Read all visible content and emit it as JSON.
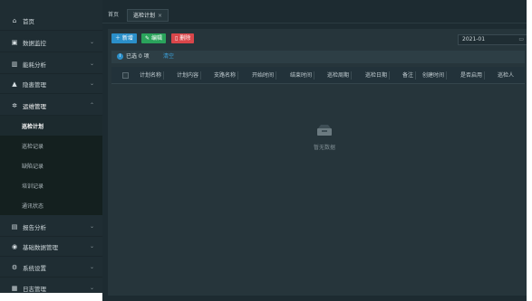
{
  "sidebar": {
    "items": [
      {
        "label": "首页",
        "icon": "home-icon",
        "has_chevron": false
      },
      {
        "label": "数据监控",
        "icon": "monitor-icon",
        "has_chevron": true
      },
      {
        "label": "能耗分析",
        "icon": "bar-chart-icon",
        "has_chevron": true
      },
      {
        "label": "隐患管理",
        "icon": "warning-icon",
        "has_chevron": true
      },
      {
        "label": "运维管理",
        "icon": "gear-icon",
        "has_chevron": true,
        "expanded": true
      }
    ],
    "sub_items": [
      {
        "label": "巡检计划",
        "selected": true
      },
      {
        "label": "巡检记录"
      },
      {
        "label": "缺陷记录"
      },
      {
        "label": "培训记录"
      },
      {
        "label": "通讯状态"
      }
    ],
    "items_after": [
      {
        "label": "报告分析",
        "icon": "report-icon"
      },
      {
        "label": "基础数据管理",
        "icon": "database-icon"
      },
      {
        "label": "系统设置",
        "icon": "settings-icon"
      },
      {
        "label": "日志管理",
        "icon": "log-icon"
      }
    ]
  },
  "tabs": {
    "home": "首页",
    "active": "巡检计划"
  },
  "toolbar": {
    "add_label": "新增",
    "edit_label": "编辑",
    "delete_label": "删除",
    "month_value": "2021-01"
  },
  "selection": {
    "text": "已选 0 项",
    "clear_label": "清空"
  },
  "table": {
    "columns": [
      "计划名称",
      "计划内容",
      "支路名称",
      "开始时间",
      "结束时间",
      "巡检周期",
      "巡检日期",
      "备注",
      "创建时间",
      "是否启用",
      "巡检人"
    ]
  },
  "empty": {
    "text": "暂无数据"
  },
  "colors": {
    "sidebar_bg": "#1f2d33",
    "main_bg": "#1d2b31",
    "add_btn": "#2b8fc9",
    "edit_btn": "#2aa35b",
    "delete_btn": "#d9464a",
    "link": "#3ca0d8"
  }
}
